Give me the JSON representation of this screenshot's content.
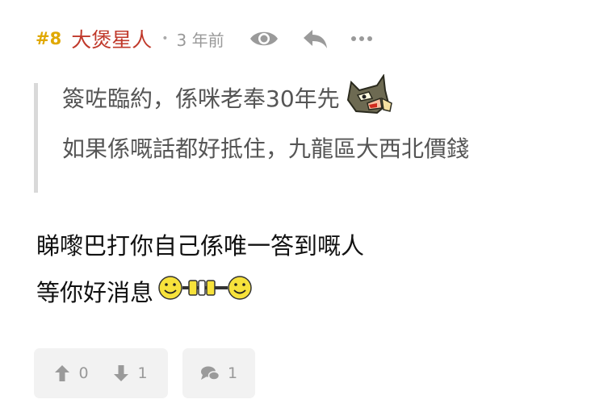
{
  "post": {
    "number": "#8",
    "username": "大煲星人",
    "separator": "•",
    "time": "3 年前"
  },
  "quote": {
    "lines": [
      "簽咗臨約，係咪老奉30年先",
      "如果係嘅話都好抵住，九龍區大西北價錢"
    ]
  },
  "body": {
    "lines": [
      "睇嚟巴打你自己係唯一答到嘅人",
      "等你好消息"
    ]
  },
  "actions": {
    "upvotes": "0",
    "downvotes": "1",
    "comments": "1"
  },
  "icons": {
    "view": "eye-icon",
    "reply": "reply-arrow-icon",
    "more": "more-dots-icon",
    "upvote": "arrow-up-icon",
    "downvote": "arrow-down-icon",
    "comment": "comment-bubble-icon"
  },
  "colors": {
    "post_number": "#e0a800",
    "username": "#c0392b",
    "muted": "#999999",
    "quote_bar": "#d9d9d9"
  }
}
